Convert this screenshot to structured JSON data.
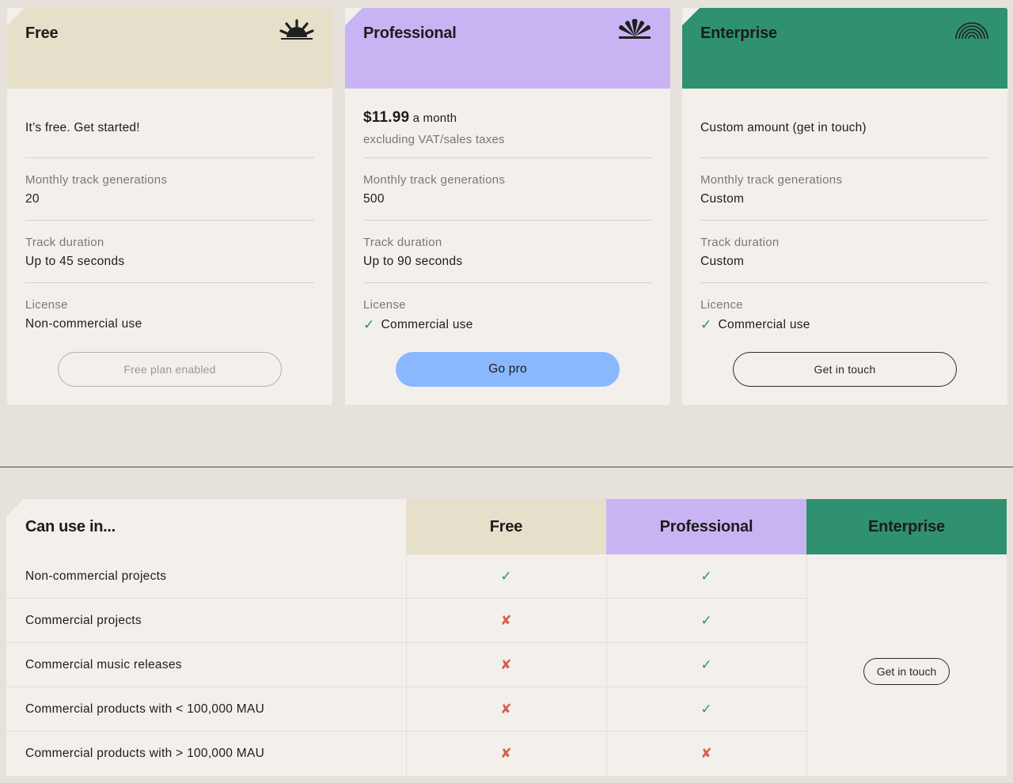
{
  "colors": {
    "page_bg": "#e6e1da",
    "card_bg": "#f3f0ec",
    "free": "#e6e0cb",
    "professional": "#c8b4f3",
    "enterprise": "#2f9170",
    "pro_button": "#8ab8ff",
    "check": "#2f8f67",
    "cross": "#d4604a"
  },
  "plans": [
    {
      "title": "Free",
      "icon": "half-sun-icon",
      "price_text": "It’s free. Get started!",
      "features": [
        {
          "label": "Monthly track generations",
          "value": "20"
        },
        {
          "label": "Track duration",
          "value": "Up to 45 seconds"
        },
        {
          "label": "License",
          "value": "Non-commercial use"
        }
      ],
      "button": "Free plan enabled"
    },
    {
      "title": "Professional",
      "icon": "fan-burst-icon",
      "price_amount": "$11.99",
      "price_period": " a month",
      "price_note": "excluding VAT/sales taxes",
      "features": [
        {
          "label": "Monthly track generations",
          "value": "500"
        },
        {
          "label": "Track duration",
          "value": "Up to 90 seconds"
        },
        {
          "label": "License",
          "value": "Commercial use",
          "check": "✓"
        }
      ],
      "button": "Go pro"
    },
    {
      "title": "Enterprise",
      "icon": "rainbow-arcs-icon",
      "price_text": "Custom amount (get in touch)",
      "features": [
        {
          "label": "Monthly track generations",
          "value": "Custom"
        },
        {
          "label": "Track duration",
          "value": "Custom"
        },
        {
          "label": "Licence",
          "value": "Commercial use",
          "check": "✓"
        }
      ],
      "button": "Get in touch"
    }
  ],
  "comparison": {
    "title": "Can use in...",
    "columns": [
      "Free",
      "Professional",
      "Enterprise"
    ],
    "rows": [
      {
        "feature": "Non-commercial projects",
        "free": "✓",
        "professional": "✓"
      },
      {
        "feature": "Commercial projects",
        "free": "✘",
        "professional": "✓"
      },
      {
        "feature": "Commercial music releases",
        "free": "✘",
        "professional": "✓"
      },
      {
        "feature": "Commercial products with < 100,000 MAU",
        "free": "✘",
        "professional": "✓"
      },
      {
        "feature": "Commercial products with > 100,000 MAU",
        "free": "✘",
        "professional": "✘"
      }
    ],
    "enterprise_button": "Get in touch"
  }
}
